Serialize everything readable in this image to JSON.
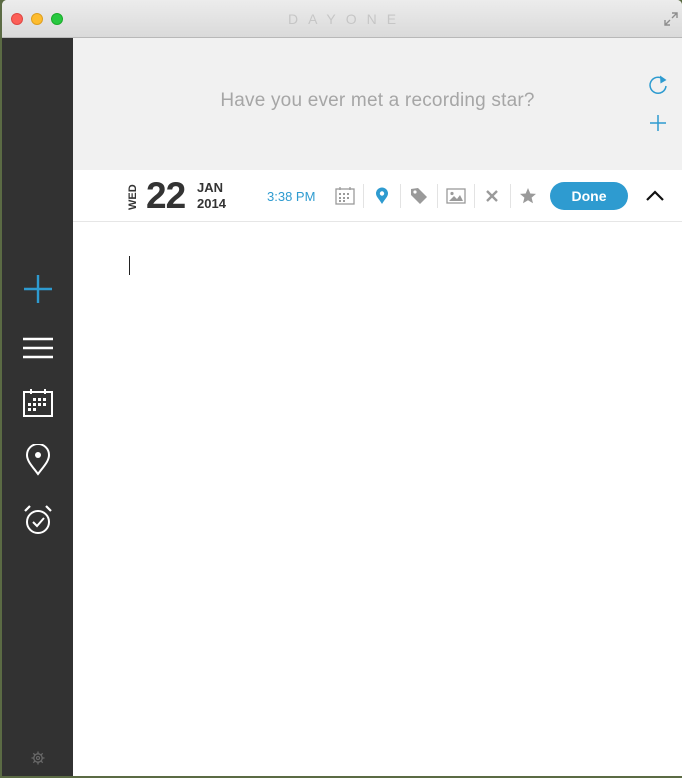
{
  "window": {
    "title": "DAYONE"
  },
  "prompt": {
    "text": "Have you ever met a recording star?"
  },
  "entry": {
    "weekday": "WED",
    "day": "22",
    "month": "JAN",
    "year": "2014",
    "time": "3:38 PM",
    "done_label": "Done"
  },
  "sidebar": {
    "items": [
      {
        "icon": "plus-icon",
        "label": ""
      },
      {
        "icon": "list-icon",
        "label": ""
      },
      {
        "icon": "calendar-icon",
        "label": ""
      },
      {
        "icon": "map-pin-icon",
        "label": ""
      },
      {
        "icon": "alarm-clock-icon",
        "label": ""
      }
    ]
  },
  "colors": {
    "accent": "#2e9bd0",
    "sidebar_bg": "#323232",
    "prompt_bg": "#f1f1f1"
  }
}
